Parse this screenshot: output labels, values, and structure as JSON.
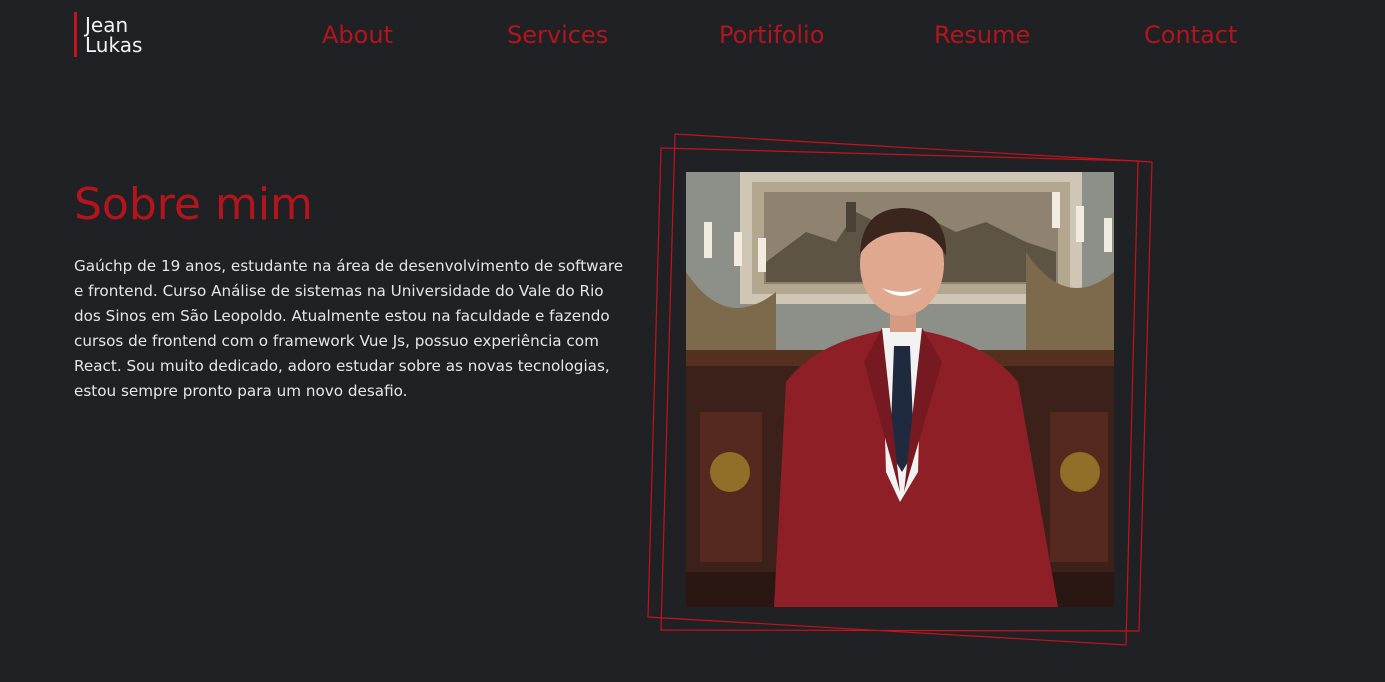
{
  "logo": {
    "line1": "Jean",
    "line2": "Lukas"
  },
  "nav": {
    "items": [
      {
        "label": "About"
      },
      {
        "label": "Services"
      },
      {
        "label": "Portifolio"
      },
      {
        "label": "Resume"
      },
      {
        "label": "Contact"
      }
    ]
  },
  "about": {
    "title": "Sobre mim",
    "paragraph": "Gaúchp de 19 anos, estudante na área de desenvolvimento de software e frontend. Curso Análise de sistemas na Universidade do Vale do Rio dos Sinos em São Leopoldo. Atualmente estou na faculdade e fazendo cursos de frontend com o framework Vue Js, possuo experiência com React. Sou muito dedicado, adoro estudar sobre as novas tecnologias, estou sempre pronto para um novo desafio."
  },
  "colors": {
    "background": "#202125",
    "accent": "#b3151c",
    "text": "#e6e6e6"
  }
}
